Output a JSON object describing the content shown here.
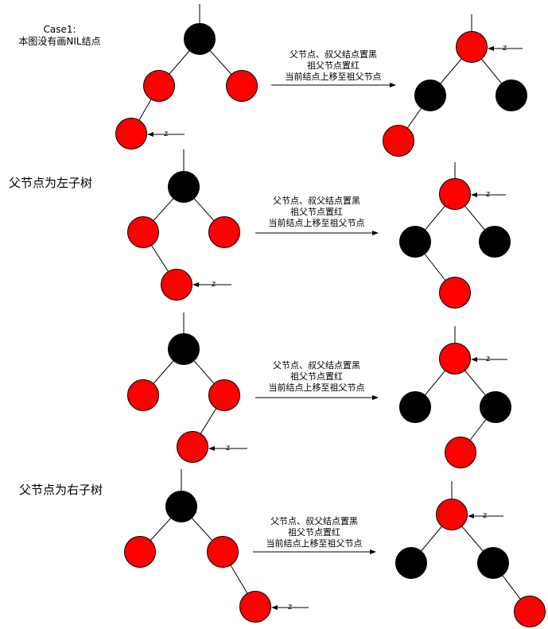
{
  "case_label": "Case1:",
  "case_note": "本图没有画NIL结点",
  "section_left": "父节点为左子树",
  "section_right": "父节点为右子树",
  "transform_lines": [
    "父节点、叔父结点置黑",
    "祖父节点置红",
    "当前结点上移至祖父节点"
  ],
  "z_label": "z",
  "colors": {
    "red": "#ff0000",
    "black": "#000000"
  }
}
